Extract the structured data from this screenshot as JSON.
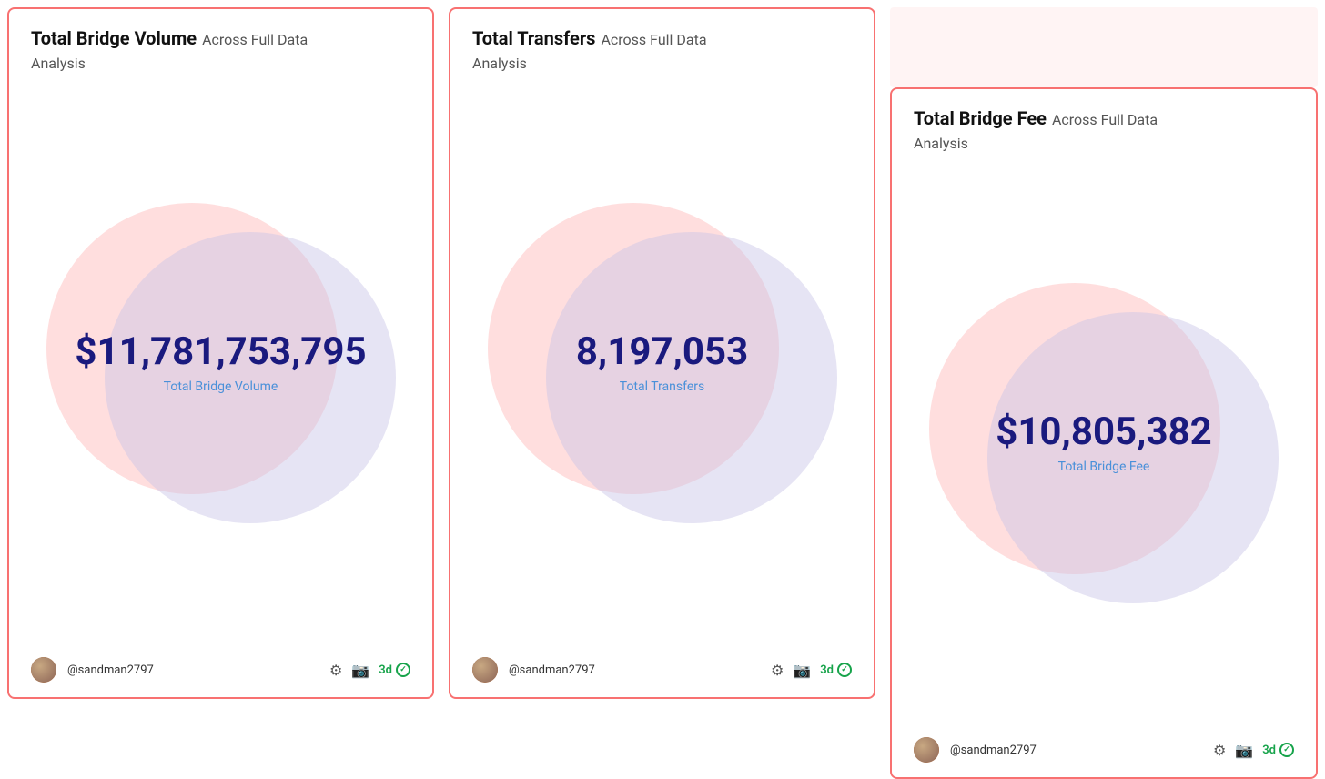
{
  "cards": [
    {
      "id": "total-bridge-volume",
      "title": "Total Bridge Volume",
      "subtitle_part1": "Across Full Data",
      "subtitle_part2": "Analysis",
      "metric_value": "$11,781,753,795",
      "metric_label": "Total Bridge Volume",
      "username": "@sandman2797",
      "badge_text": "3d",
      "footer_icon1": "⚙",
      "footer_icon2": "📷"
    },
    {
      "id": "total-transfers",
      "title": "Total Transfers",
      "subtitle_part1": "Across Full Data",
      "subtitle_part2": "Analysis",
      "metric_value": "8,197,053",
      "metric_label": "Total Transfers",
      "username": "@sandman2797",
      "badge_text": "3d",
      "footer_icon1": "⚙",
      "footer_icon2": "📷"
    },
    {
      "id": "total-bridge-fee",
      "title": "Total Bridge Fee",
      "subtitle_part1": "Across Full Data",
      "subtitle_part2": "Analysis",
      "metric_value": "$10,805,382",
      "metric_label": "Total Bridge Fee",
      "username": "@sandman2797",
      "badge_text": "3d",
      "footer_icon1": "⚙",
      "footer_icon2": "📷"
    }
  ]
}
